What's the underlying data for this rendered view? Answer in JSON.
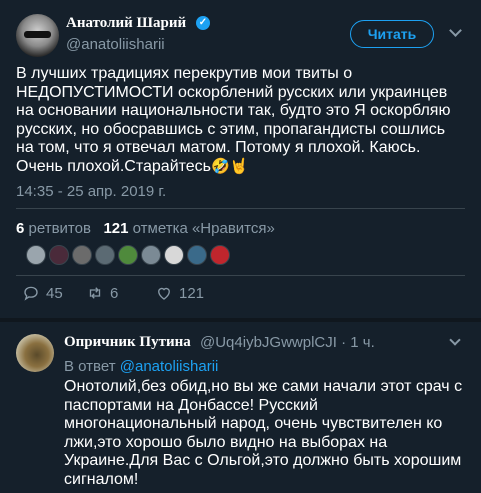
{
  "main_tweet": {
    "display_name": "Анатолий Шарий",
    "handle": "@anatoliisharii",
    "follow_label": "Читать",
    "text": "В лучших традициях перекрутив мои твиты о НЕДОПУСТИМОСТИ оскорблений русских или украинцев на основании национальности так, будто это Я оскорбляю русских, но обосравшись с этим, пропагандисты сошлись на том, что я отвечал матом. Потому я плохой. Каюсь. Очень плохой.Старайтесь",
    "emojis": "🤣🤘",
    "timestamp": "14:35 - 25 апр. 2019 г.",
    "retweets_count": "6",
    "retweets_label": "ретвитов",
    "likes_count": "121",
    "likes_label": "отметка «Нравится»",
    "actions": {
      "replies": "45",
      "retweets": "6",
      "likes": "121"
    },
    "likers": [
      {
        "color": "#9aa5ad"
      },
      {
        "color": "#4a2a3a"
      },
      {
        "color": "#6b6b6b"
      },
      {
        "color": "#5b6a73"
      },
      {
        "color": "#4f8a3c"
      },
      {
        "color": "#7b8a95"
      },
      {
        "color": "#d8d8d8"
      },
      {
        "color": "#3a6a8a"
      },
      {
        "color": "#c0262d"
      }
    ],
    "colors": {
      "accent": "#1da1f2",
      "background": "#15202b",
      "muted_text": "#8899a6"
    }
  },
  "reply_tweet": {
    "display_name": "Опричник Путина",
    "handle_time": "@Uq4iybJGwwplCJI · 1 ч.",
    "in_reply_prefix": "В ответ",
    "in_reply_mention": "@anatoliisharii",
    "text": "Онотолий,без обид,но вы же сами начали этот срач с паспортами на Донбассе! Русский многонациональный народ, очень чувствителен ко лжи,это хорошо было видно на выборах на Украине.Для Вас с Ольгой,это должно быть хорошим сигналом!"
  }
}
